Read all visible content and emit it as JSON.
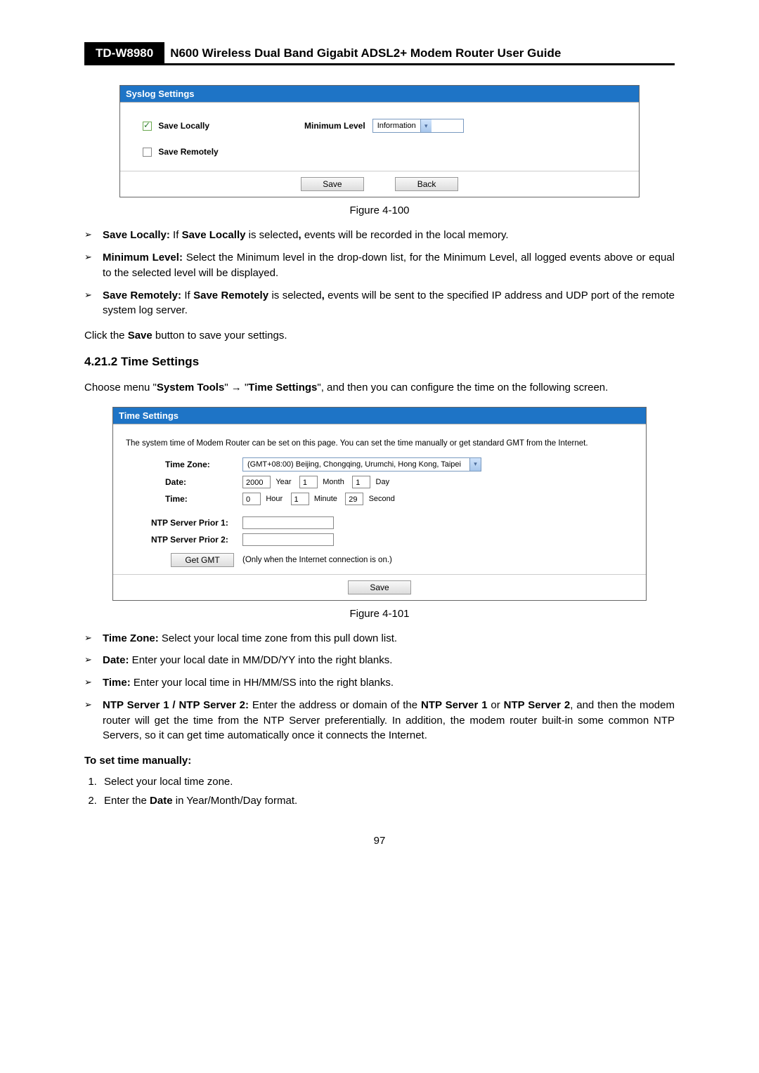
{
  "header": {
    "model": "TD-W8980",
    "title": "N600 Wireless Dual Band Gigabit ADSL2+ Modem Router User Guide"
  },
  "syslog": {
    "panel_title": "Syslog Settings",
    "save_locally_label": "Save Locally",
    "save_remotely_label": "Save Remotely",
    "min_level_label": "Minimum Level",
    "min_level_value": "Information",
    "save_btn": "Save",
    "back_btn": "Back",
    "figure_caption": "Figure 4-100"
  },
  "bullets1": {
    "b1_strong1": "Save Locally:",
    "b1_text1": " If ",
    "b1_strong2": "Save Locally",
    "b1_text2": " is selected",
    "b1_strong3": ",",
    "b1_text3": " events will be recorded in the local memory.",
    "b2_strong": "Minimum Level:",
    "b2_text": " Select the Minimum level in the drop-down list, for the Minimum Level, all logged events above or equal to the selected level will be displayed.",
    "b3_strong1": "Save Remotely:",
    "b3_text1": " If ",
    "b3_strong2": "Save Remotely",
    "b3_text2": " is selected",
    "b3_strong3": ",",
    "b3_text3": " events will be sent to the specified IP address and UDP port of the remote system log server."
  },
  "mid": {
    "click_save_pre": "Click the ",
    "click_save_strong": "Save",
    "click_save_post": " button to save your settings.",
    "section_heading": "4.21.2 Time Settings",
    "choose_pre": "Choose menu \"",
    "choose_s1": "System Tools",
    "choose_mid": "\"  →  \"",
    "choose_s2": "Time Settings",
    "choose_post": "\", and then you can configure the time on the following screen."
  },
  "timeset": {
    "panel_title": "Time Settings",
    "intro": "The system time of Modem Router can be set on this page. You can set the time manually or get standard GMT from the Internet.",
    "tz_label": "Time Zone:",
    "tz_value": "(GMT+08:00) Beijing, Chongqing, Urumchi, Hong Kong, Taipei",
    "date_label": "Date:",
    "year_val": "2000",
    "year_lbl": "Year",
    "month_val": "1",
    "month_lbl": "Month",
    "day_val": "1",
    "day_lbl": "Day",
    "time_label": "Time:",
    "hour_val": "0",
    "hour_lbl": "Hour",
    "min_val": "1",
    "min_lbl": "Minute",
    "sec_val": "29",
    "sec_lbl": "Second",
    "ntp1_label": "NTP Server Prior 1:",
    "ntp2_label": "NTP Server Prior 2:",
    "getgmt_btn": "Get GMT",
    "getgmt_note": "(Only when the Internet connection is on.)",
    "save_btn": "Save",
    "figure_caption": "Figure 4-101"
  },
  "bullets2": {
    "b1_strong": "Time Zone:",
    "b1_text": " Select your local time zone from this pull down list.",
    "b2_strong": "Date:",
    "b2_text": " Enter your local date in MM/DD/YY into the right blanks.",
    "b3_strong": "Time:",
    "b3_text": " Enter your local time in HH/MM/SS into the right blanks.",
    "b4_strong1": "NTP Server 1 / NTP Server 2:",
    "b4_text1": " Enter the address or domain of the ",
    "b4_strong2": "NTP Server 1",
    "b4_text2": " or ",
    "b4_strong3": "NTP Server 2",
    "b4_text3": ", and then the modem router will get the time from the NTP Server preferentially. In addition, the modem router built-in some common NTP Servers, so it can get time automatically once it connects the Internet."
  },
  "tail": {
    "manual_heading": "To set time manually:",
    "step1": "Select your local time zone.",
    "step2_pre": "Enter the ",
    "step2_strong": "Date",
    "step2_post": " in Year/Month/Day format."
  },
  "page_number": "97"
}
